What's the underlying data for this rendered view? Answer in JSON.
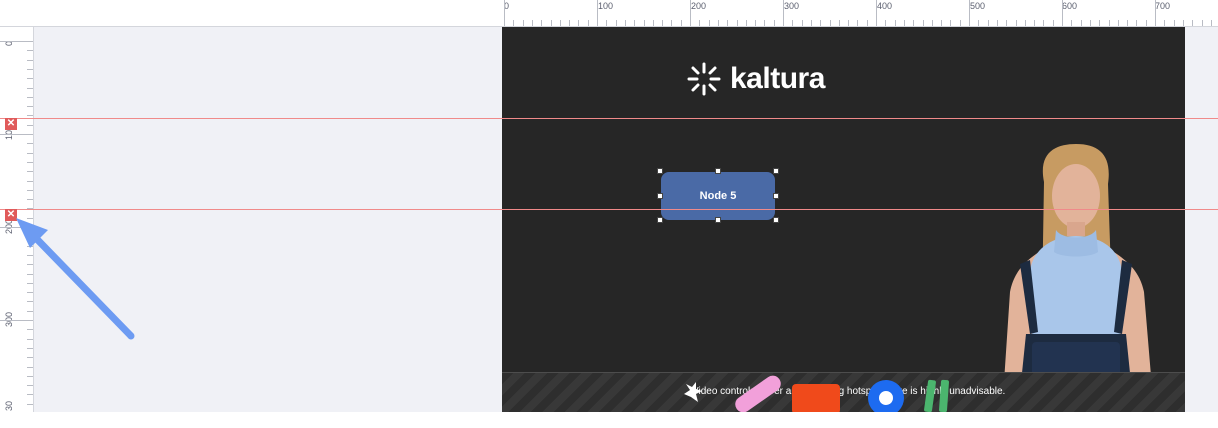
{
  "top_ruler": {
    "labels": [
      "0",
      "100",
      "200",
      "300",
      "400",
      "500",
      "600",
      "700"
    ]
  },
  "left_ruler": {
    "labels": [
      "0",
      "100",
      "200",
      "300",
      "30"
    ]
  },
  "stage": {
    "logo_text": "kaltura",
    "node_label": "Node 5",
    "video_zone_text": "Video controls hover area. Placing hotspots here is highly unadvisable."
  },
  "guides": [
    {
      "delete_label": "✕"
    },
    {
      "delete_label": "✕"
    }
  ],
  "colors": {
    "stage_bg": "#262626",
    "node_fill": "#4a6aa6",
    "guide_line": "#f08a8a",
    "guide_delete": "#e05a5a",
    "annotation_arrow": "#6d9bf2",
    "workspace_bg": "#f0f1f6"
  },
  "icons": {
    "logo": "kaltura-burst-icon",
    "guide_delete": "close-icon",
    "annotation": "arrow-icon"
  }
}
